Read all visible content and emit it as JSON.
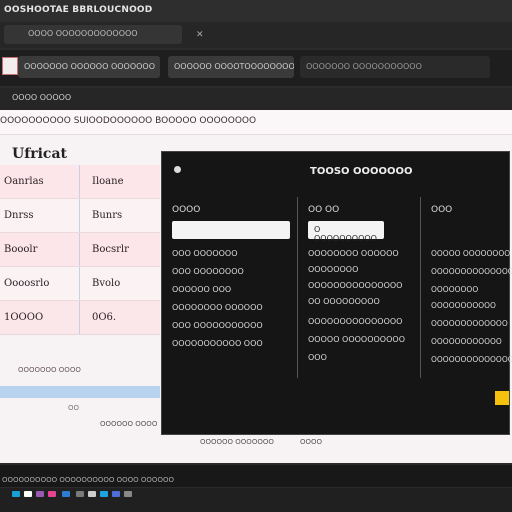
{
  "titlebar": {
    "title": "OOSHOOTAE BBRLOUCNOOD"
  },
  "browser": {
    "tab_label": "OOOO OOOOOOOOOOOOO",
    "tab_close": "✕",
    "field1": "OOOOOOO OOOOOO OOOOOOO",
    "field2": "OOOOOO OOOOTOOOOOOOOOO",
    "field3": "OOOOOOO OOOOOOOOOOO",
    "subtext": "OOOO OOOOO"
  },
  "window": {
    "menubar": "OOOOOOOOOO SUIOODOOOOOO BOOOOO OOOOOOOO",
    "page_title": "Ufricat",
    "table": [
      {
        "c1": "Oanrlas",
        "c2": "Iloane"
      },
      {
        "c1": "Dnrss",
        "c2": "Bunrs"
      },
      {
        "c1": "Booolr",
        "c2": "Bocsrlr"
      },
      {
        "c1": "Oooosrlo",
        "c2": "Bvolo"
      },
      {
        "c1": "1OOOO",
        "c2": "0O6."
      }
    ],
    "footnote": "OOOOOOO OOOO",
    "lower1": "OO",
    "lower2": "OOOOOO OOOO",
    "lower3": "OOOOOO OOOOOOO",
    "lower4": "OOOO"
  },
  "popup": {
    "title": "TOOSO OOOOOOO",
    "col1": {
      "head": "OOOO",
      "input": "",
      "items": [
        "OOO OOOOOOO",
        "OOO OOOOOOOO",
        "OOOOOO OOO",
        "OOOOOOOO OOOOOO",
        "OOO OOOOOOOOOOO",
        "OOOOOOOOOOO OOO"
      ]
    },
    "col2": {
      "head": "OO OO",
      "input": "O OOOOOOOOOO",
      "items": [
        "OOOOOOOO OOOOOO",
        "OOOOOOOO",
        "OOOOOOOOOOOOOOO",
        "OO OOOOOOOOO",
        "OOOOOOOOOOOOOOO",
        "OOOOO OOOOOOOOOO",
        "OOO"
      ]
    },
    "col3": {
      "head": "OOO",
      "items": [
        "OOOOO OOOOOOOO",
        "OOOOOOOOOOOOOOO",
        "OOOOOOOO",
        "OOOOOOOOOOO",
        "OOOOOOOOOOOOO",
        "OOOOOOOOOOOO",
        "OOOOOOOOOOOOOOO"
      ]
    }
  },
  "status": {
    "text": "OOOOOOOOOO OOOOOOOOOO OOOO OOOOOO"
  },
  "taskbar_colors": [
    "#18a0d8",
    "#ffffff",
    "#9b59b6",
    "#e84393",
    "#2b7cd3",
    "#7a7a7a",
    "#cccccc",
    "#1ca5e0",
    "#4d6ed8",
    "#888888"
  ]
}
